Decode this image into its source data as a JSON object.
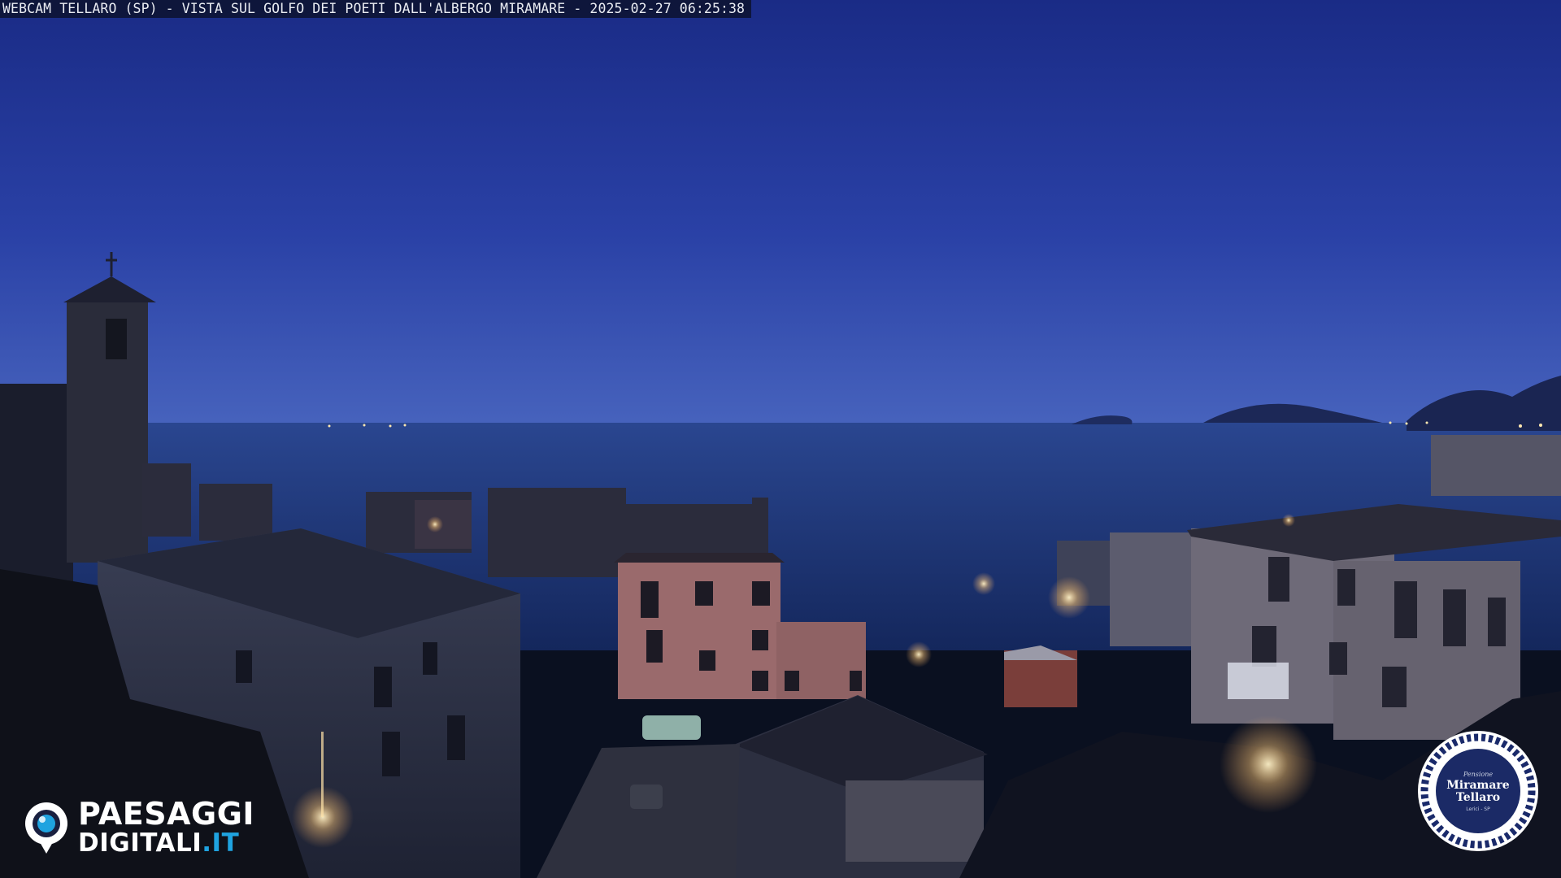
{
  "header": {
    "caption": "WEBCAM TELLARO (SP) - VISTA SUL GOLFO DEI POETI DALL'ALBERGO MIRAMARE - 2025-02-27 06:25:38"
  },
  "branding": {
    "line1": "PAESAGGI",
    "line2_main": "DIGITALI",
    "line2_accent": ".IT",
    "accent_color": "#1fa3e0"
  },
  "seal": {
    "small": "Pensione",
    "name_line1": "Miramare",
    "name_line2": "Tellaro",
    "location": "Lerici - SP"
  },
  "colors": {
    "sky_top": "#1c2f8c",
    "sky_horizon": "#3b56b8",
    "sea": "#1f3778",
    "town_dark": "#161a28",
    "pink_house": "#b07a7a",
    "lamp_glow": "#ffd89a"
  }
}
